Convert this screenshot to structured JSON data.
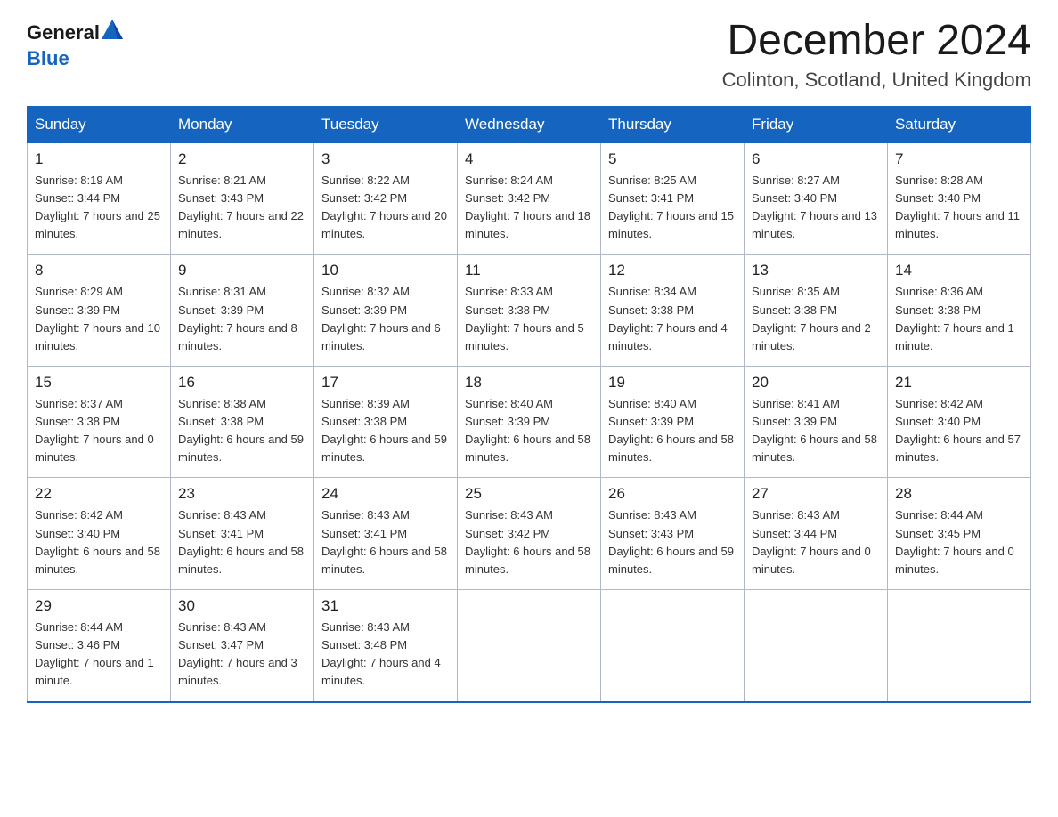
{
  "header": {
    "logo_general": "General",
    "logo_blue": "Blue",
    "title": "December 2024",
    "subtitle": "Colinton, Scotland, United Kingdom"
  },
  "days_of_week": [
    "Sunday",
    "Monday",
    "Tuesday",
    "Wednesday",
    "Thursday",
    "Friday",
    "Saturday"
  ],
  "weeks": [
    [
      {
        "day": "1",
        "sunrise": "8:19 AM",
        "sunset": "3:44 PM",
        "daylight": "7 hours and 25 minutes."
      },
      {
        "day": "2",
        "sunrise": "8:21 AM",
        "sunset": "3:43 PM",
        "daylight": "7 hours and 22 minutes."
      },
      {
        "day": "3",
        "sunrise": "8:22 AM",
        "sunset": "3:42 PM",
        "daylight": "7 hours and 20 minutes."
      },
      {
        "day": "4",
        "sunrise": "8:24 AM",
        "sunset": "3:42 PM",
        "daylight": "7 hours and 18 minutes."
      },
      {
        "day": "5",
        "sunrise": "8:25 AM",
        "sunset": "3:41 PM",
        "daylight": "7 hours and 15 minutes."
      },
      {
        "day": "6",
        "sunrise": "8:27 AM",
        "sunset": "3:40 PM",
        "daylight": "7 hours and 13 minutes."
      },
      {
        "day": "7",
        "sunrise": "8:28 AM",
        "sunset": "3:40 PM",
        "daylight": "7 hours and 11 minutes."
      }
    ],
    [
      {
        "day": "8",
        "sunrise": "8:29 AM",
        "sunset": "3:39 PM",
        "daylight": "7 hours and 10 minutes."
      },
      {
        "day": "9",
        "sunrise": "8:31 AM",
        "sunset": "3:39 PM",
        "daylight": "7 hours and 8 minutes."
      },
      {
        "day": "10",
        "sunrise": "8:32 AM",
        "sunset": "3:39 PM",
        "daylight": "7 hours and 6 minutes."
      },
      {
        "day": "11",
        "sunrise": "8:33 AM",
        "sunset": "3:38 PM",
        "daylight": "7 hours and 5 minutes."
      },
      {
        "day": "12",
        "sunrise": "8:34 AM",
        "sunset": "3:38 PM",
        "daylight": "7 hours and 4 minutes."
      },
      {
        "day": "13",
        "sunrise": "8:35 AM",
        "sunset": "3:38 PM",
        "daylight": "7 hours and 2 minutes."
      },
      {
        "day": "14",
        "sunrise": "8:36 AM",
        "sunset": "3:38 PM",
        "daylight": "7 hours and 1 minute."
      }
    ],
    [
      {
        "day": "15",
        "sunrise": "8:37 AM",
        "sunset": "3:38 PM",
        "daylight": "7 hours and 0 minutes."
      },
      {
        "day": "16",
        "sunrise": "8:38 AM",
        "sunset": "3:38 PM",
        "daylight": "6 hours and 59 minutes."
      },
      {
        "day": "17",
        "sunrise": "8:39 AM",
        "sunset": "3:38 PM",
        "daylight": "6 hours and 59 minutes."
      },
      {
        "day": "18",
        "sunrise": "8:40 AM",
        "sunset": "3:39 PM",
        "daylight": "6 hours and 58 minutes."
      },
      {
        "day": "19",
        "sunrise": "8:40 AM",
        "sunset": "3:39 PM",
        "daylight": "6 hours and 58 minutes."
      },
      {
        "day": "20",
        "sunrise": "8:41 AM",
        "sunset": "3:39 PM",
        "daylight": "6 hours and 58 minutes."
      },
      {
        "day": "21",
        "sunrise": "8:42 AM",
        "sunset": "3:40 PM",
        "daylight": "6 hours and 57 minutes."
      }
    ],
    [
      {
        "day": "22",
        "sunrise": "8:42 AM",
        "sunset": "3:40 PM",
        "daylight": "6 hours and 58 minutes."
      },
      {
        "day": "23",
        "sunrise": "8:43 AM",
        "sunset": "3:41 PM",
        "daylight": "6 hours and 58 minutes."
      },
      {
        "day": "24",
        "sunrise": "8:43 AM",
        "sunset": "3:41 PM",
        "daylight": "6 hours and 58 minutes."
      },
      {
        "day": "25",
        "sunrise": "8:43 AM",
        "sunset": "3:42 PM",
        "daylight": "6 hours and 58 minutes."
      },
      {
        "day": "26",
        "sunrise": "8:43 AM",
        "sunset": "3:43 PM",
        "daylight": "6 hours and 59 minutes."
      },
      {
        "day": "27",
        "sunrise": "8:43 AM",
        "sunset": "3:44 PM",
        "daylight": "7 hours and 0 minutes."
      },
      {
        "day": "28",
        "sunrise": "8:44 AM",
        "sunset": "3:45 PM",
        "daylight": "7 hours and 0 minutes."
      }
    ],
    [
      {
        "day": "29",
        "sunrise": "8:44 AM",
        "sunset": "3:46 PM",
        "daylight": "7 hours and 1 minute."
      },
      {
        "day": "30",
        "sunrise": "8:43 AM",
        "sunset": "3:47 PM",
        "daylight": "7 hours and 3 minutes."
      },
      {
        "day": "31",
        "sunrise": "8:43 AM",
        "sunset": "3:48 PM",
        "daylight": "7 hours and 4 minutes."
      },
      null,
      null,
      null,
      null
    ]
  ]
}
